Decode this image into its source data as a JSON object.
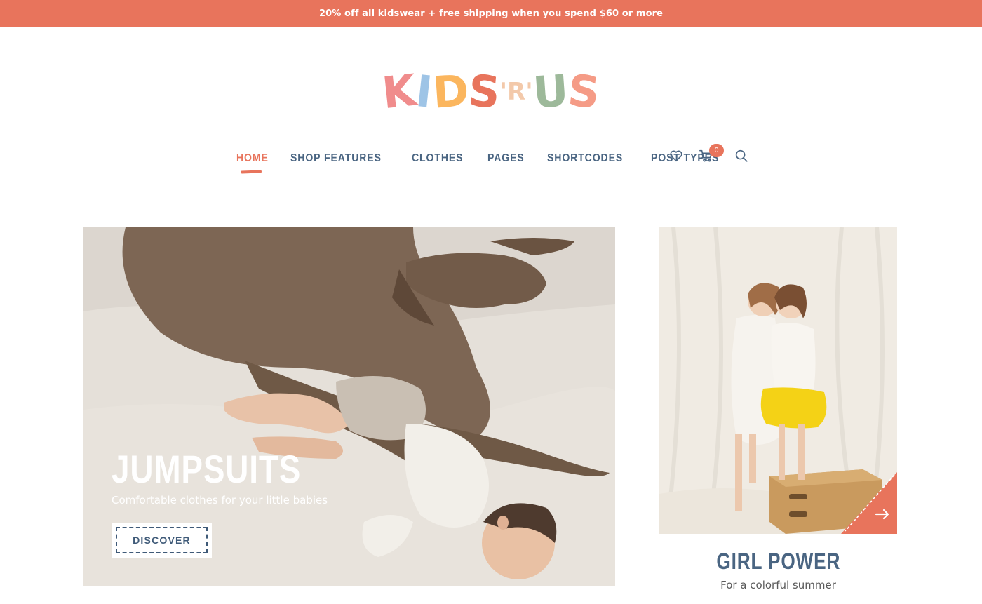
{
  "promo": {
    "text": "20% off all kidswear + free shipping when you spend $60 or more"
  },
  "logo": {
    "letters": [
      "K",
      "I",
      "D",
      "S",
      "'R'",
      "U",
      "S"
    ],
    "colors": [
      "#f08c8c",
      "#9ec4e6",
      "#fbb65e",
      "#e8745c",
      "#f3c9aa",
      "#9db99a",
      "#f59b86"
    ]
  },
  "nav": {
    "items": [
      "HOME",
      "SHOP FEATURES",
      "CLOTHES",
      "PAGES",
      "SHORTCODES",
      "POST TYPES"
    ],
    "active": "HOME",
    "icons": [
      "heart-icon",
      "cart-icon",
      "search-icon"
    ],
    "cart_count": "0"
  },
  "hero": {
    "title": "JUMPSUITS",
    "subtitle": "Comfortable clothes for your little babies",
    "button": "DISCOVER"
  },
  "side_card": {
    "title": "GIRL POWER",
    "subtitle": "For a colorful summer",
    "arrow_icon": "arrow-right-icon"
  },
  "colors": {
    "accent": "#e8745c",
    "text": "#4a6582"
  }
}
